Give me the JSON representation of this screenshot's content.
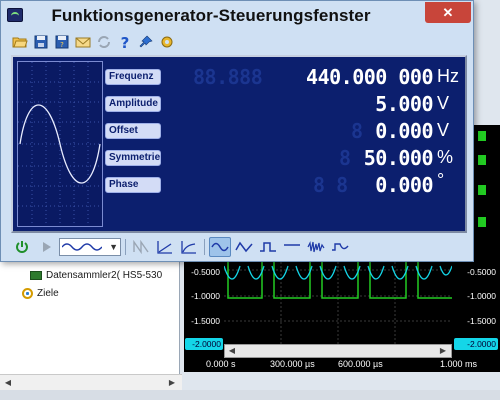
{
  "window": {
    "title": "Funktionsgenerator-Steuerungsfenster",
    "close_label": "✕"
  },
  "toolbar": {
    "buttons": [
      "open-icon",
      "save-icon",
      "save-as-icon",
      "email-icon",
      "refresh-icon",
      "help-icon",
      "pin-icon",
      "settings-icon"
    ]
  },
  "parameters": [
    {
      "label": "Frequenz",
      "ghost": "88.888",
      "value": "440.000 000",
      "unit": "Hz"
    },
    {
      "label": "Amplitude",
      "ghost": "",
      "value": "5.000",
      "unit": "V"
    },
    {
      "label": "Offset",
      "ghost": "8",
      "value": "0.000",
      "unit": "V"
    },
    {
      "label": "Symmetrie",
      "ghost": "8",
      "value": "50.000",
      "unit": "%"
    },
    {
      "label": "Phase",
      "ghost": "8 8",
      "value": "0.000",
      "unit": "°"
    }
  ],
  "bottom_bar": {
    "buttons": [
      "power-icon",
      "play-icon",
      "waveform-select",
      "sweep-icon",
      "linear-ramp-icon",
      "log-ramp-icon",
      "sine-wave-icon",
      "triangle-wave-icon",
      "square-wave-icon",
      "dc-icon",
      "noise-icon",
      "arbitrary-wave-icon"
    ],
    "active": "sine-wave-icon"
  },
  "background": {
    "tree": {
      "item_datasammler": "Datensammler2( HS5-530",
      "item_ziele": "Ziele"
    },
    "scope": {
      "y_ticks_left": [
        "-0.5000",
        "-1.0000",
        "-1.5000",
        "-2.0000"
      ],
      "y_ticks_right": [
        "-0.5000",
        "-1.0000",
        "-1.5000",
        "-2.0000"
      ],
      "time_ticks": [
        "0.000 s",
        "300.000 µs",
        "600.000 µs",
        "1.000 ms"
      ]
    }
  },
  "colors": {
    "panel_bg": "#0c1f6e",
    "trace_cyan": "#14d6e8",
    "trace_green": "#22cc22",
    "close_red": "#c8453a"
  }
}
